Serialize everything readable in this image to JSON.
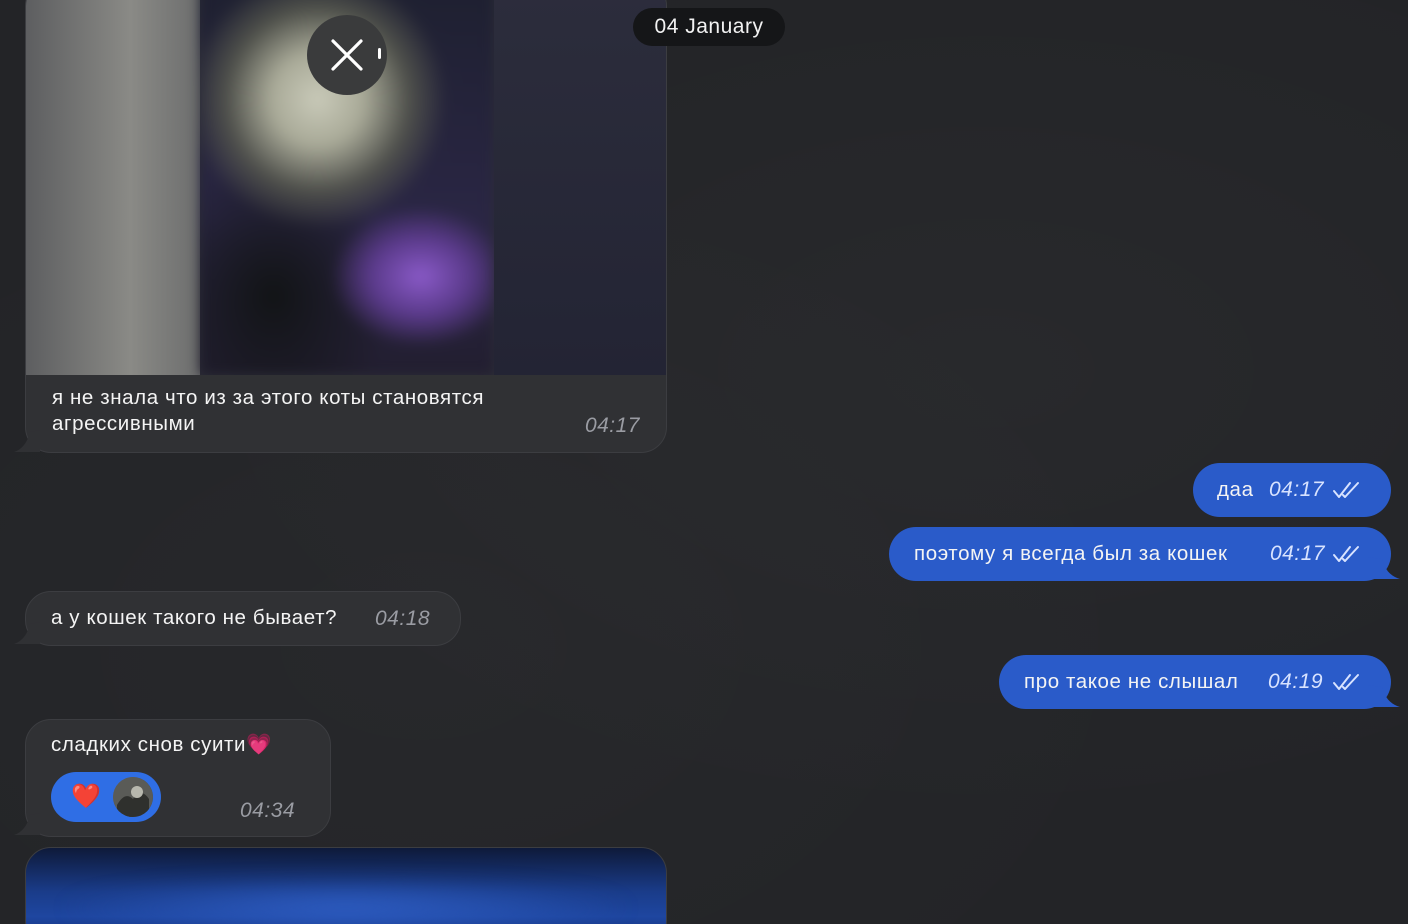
{
  "date_separator": "04 January",
  "messages": [
    {
      "id": "m1",
      "direction": "incoming",
      "type": "media",
      "caption": "я не знала что из за этого коты становятся агрессивными",
      "time": "04:17"
    },
    {
      "id": "m2",
      "direction": "outgoing",
      "text": "даа",
      "time": "04:17",
      "status": "read"
    },
    {
      "id": "m3",
      "direction": "outgoing",
      "text": "поэтому я всегда был за кошек",
      "time": "04:17",
      "status": "read"
    },
    {
      "id": "m4",
      "direction": "incoming",
      "text": "а у кошек такого не бывает?",
      "time": "04:18"
    },
    {
      "id": "m5",
      "direction": "outgoing",
      "text": "про такое не слышал",
      "time": "04:19",
      "status": "read"
    },
    {
      "id": "m6",
      "direction": "incoming",
      "text": "сладких снов суити💗",
      "time": "04:34",
      "reaction": {
        "emoji": "❤️"
      }
    }
  ],
  "colors": {
    "background": "#232427",
    "incoming_bubble": "#303134",
    "outgoing_bubble": "#2a5bc9",
    "reaction_pill": "#2f6ee5",
    "date_pill": "#151618"
  },
  "icons": {
    "close": "close-icon",
    "read_receipt": "double-check-icon",
    "reaction_avatar": "avatar"
  }
}
